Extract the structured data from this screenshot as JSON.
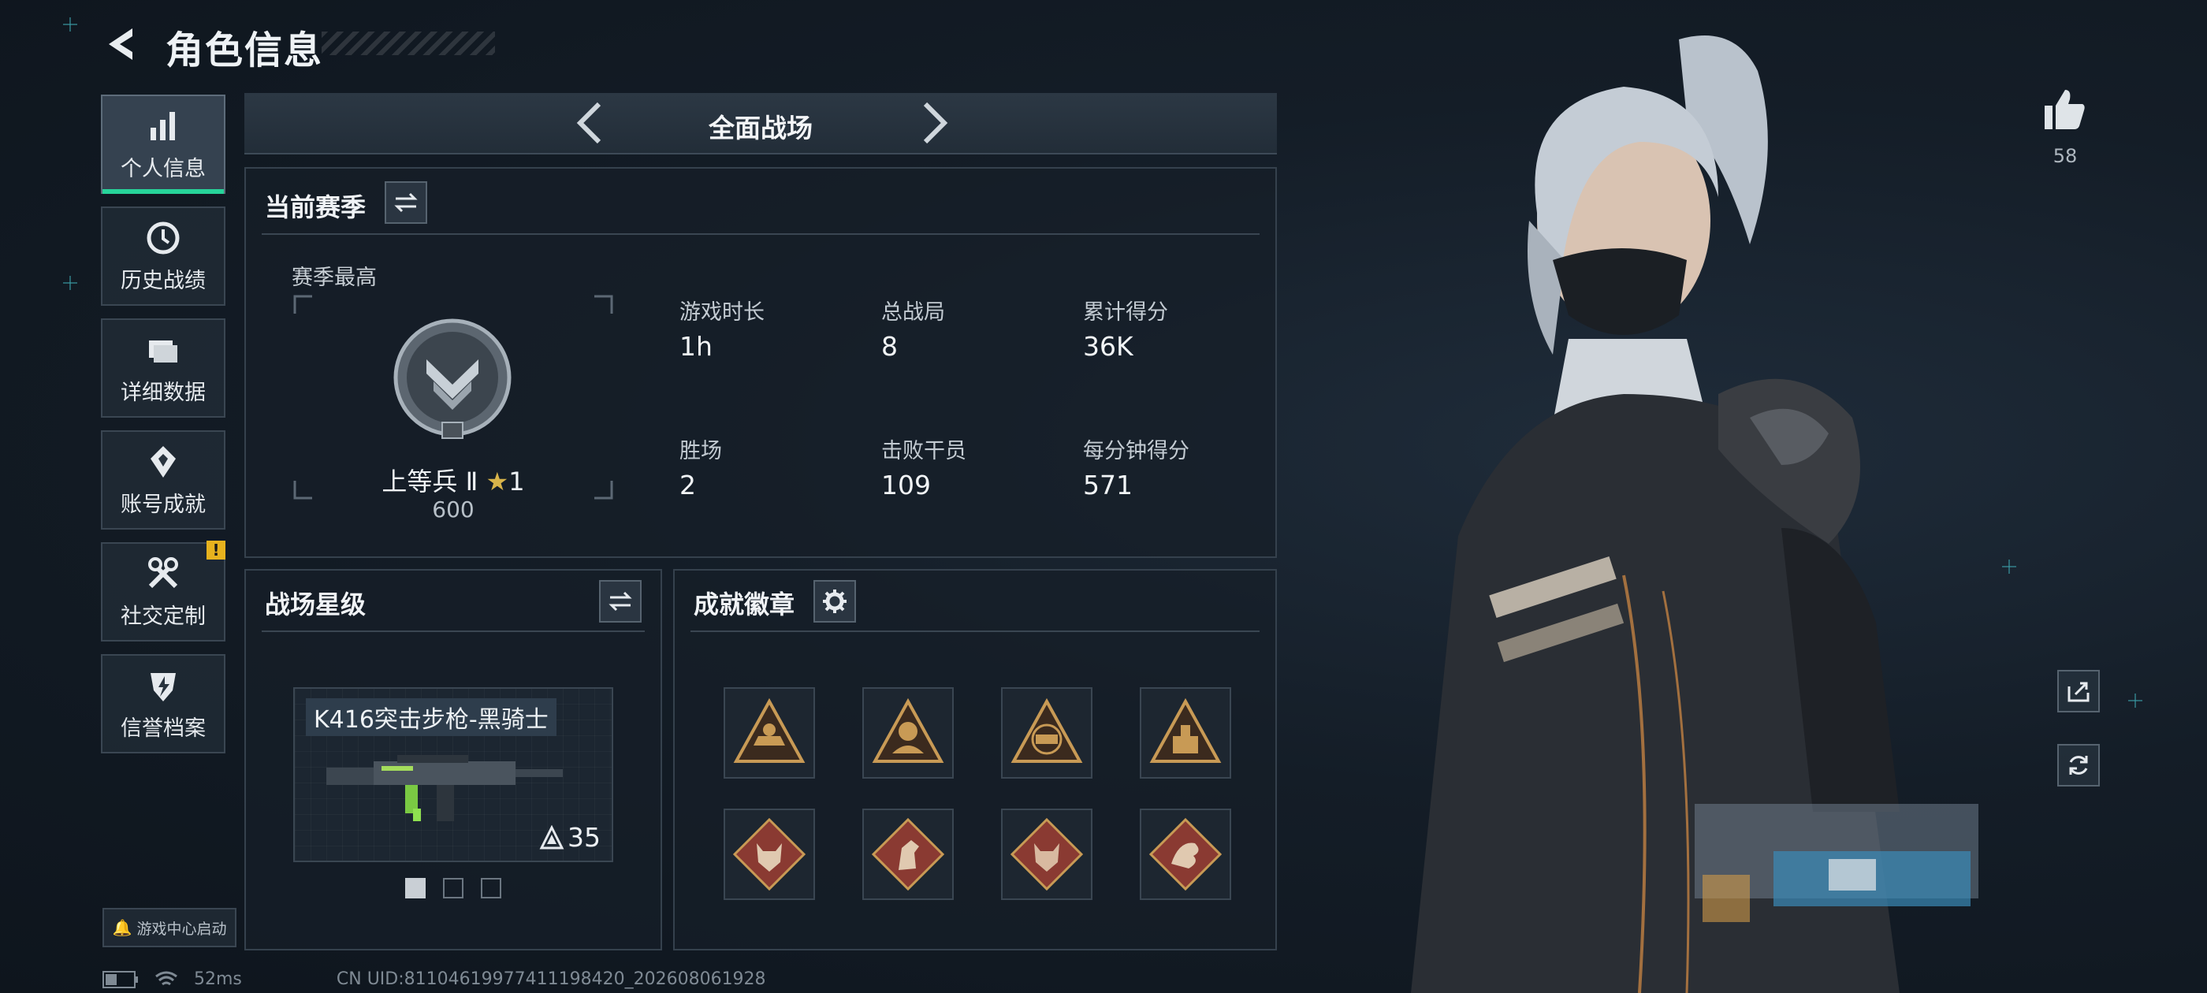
{
  "header": {
    "title": "角色信息"
  },
  "sidebar": {
    "items": [
      {
        "label": "个人信息",
        "icon": "bar-chart-icon",
        "active": true
      },
      {
        "label": "历史战绩",
        "icon": "history-icon"
      },
      {
        "label": "详细数据",
        "icon": "folder-icon"
      },
      {
        "label": "账号成就",
        "icon": "achievement-icon"
      },
      {
        "label": "社交定制",
        "icon": "tools-icon",
        "alert": "!"
      },
      {
        "label": "信誉档案",
        "icon": "shield-lightning-icon"
      }
    ],
    "game_center": "游戏中心启动"
  },
  "mode": {
    "label": "全面战场"
  },
  "season": {
    "title": "当前赛季",
    "best_label": "赛季最高",
    "rank_name": "上等兵 Ⅱ",
    "rank_stars": "1",
    "rank_score": "600",
    "stats": [
      {
        "label": "游戏时长",
        "value": "1h"
      },
      {
        "label": "总战局",
        "value": "8"
      },
      {
        "label": "累计得分",
        "value": "36K"
      },
      {
        "label": "胜场",
        "value": "2"
      },
      {
        "label": "击败干员",
        "value": "109"
      },
      {
        "label": "每分钟得分",
        "value": "571"
      }
    ]
  },
  "star_level": {
    "title": "战场星级",
    "weapon_name": "K416突击步枪-黑骑士",
    "weapon_level": "35"
  },
  "badges": {
    "title": "成就徽章",
    "icons": [
      "vehicle-badge-icon",
      "soldier-badge-icon",
      "eri-badge-icon",
      "supply-badge-icon",
      "wolf-badge-icon",
      "horse-badge-icon",
      "wolf-badge-icon",
      "dragon-badge-icon"
    ]
  },
  "status": {
    "ping": "52ms",
    "uid": "CN UID:81104619977411198420_202608061928"
  },
  "likes": {
    "count": "58"
  },
  "colors": {
    "accent_green": "#27d49a",
    "badge_gold": "#c89a55",
    "badge_red": "#8a3a32",
    "alert_yellow": "#e7b21e"
  }
}
